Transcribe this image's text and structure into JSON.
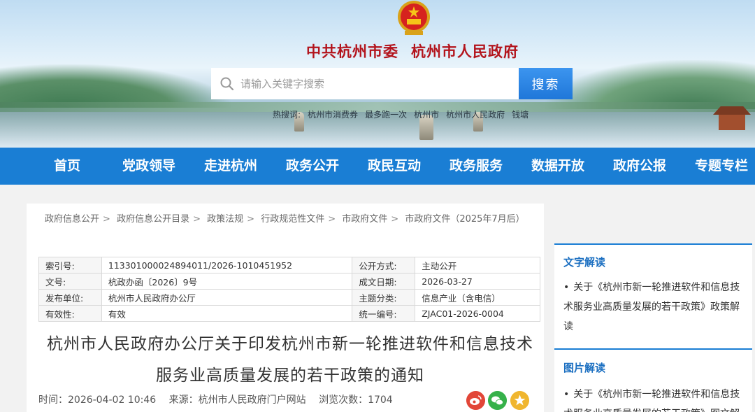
{
  "header": {
    "emblem_icon": "national-emblem-icon",
    "title_left": "中共杭州市委",
    "title_right": "杭州市人民政府"
  },
  "search": {
    "placeholder": "请输入关键字搜索",
    "button_label": "搜索",
    "hot_links": [
      "热搜词:",
      "杭州市消费券",
      "最多跑一次",
      "杭州市",
      "杭州市人民政府",
      "钱塘"
    ]
  },
  "nav": {
    "items": [
      "首页",
      "党政领导",
      "走进杭州",
      "政务公开",
      "政民互动",
      "政务服务",
      "数据开放",
      "政府公报",
      "专题专栏"
    ]
  },
  "breadcrumb": [
    "政府信息公开",
    "政府信息公开目录",
    "政策法规",
    "行政规范性文件",
    "市政府文件",
    "市政府文件（2025年7月后）"
  ],
  "info_table": {
    "rows": [
      {
        "label": "索引号:",
        "value": "113301000024894011/2026-1010451952",
        "label2": "公开方式:",
        "value2": "主动公开"
      },
      {
        "label": "文号:",
        "value": "杭政办函〔2026〕9号",
        "label2": "成文日期:",
        "value2": "2026-03-27"
      },
      {
        "label": "发布单位:",
        "value": "杭州市人民政府办公厅",
        "label2": "主题分类:",
        "value2": "信息产业（含电信）"
      },
      {
        "label": "有效性:",
        "value": "有效",
        "label2": "统一编号:",
        "value2": "ZJAC01-2026-0004"
      }
    ]
  },
  "document": {
    "title_line1": "杭州市人民政府办公厅关于印发杭州市新一轮推进软件和信息技术",
    "title_line2": "服务业高质量发展的若干政策的通知",
    "time": "时间：2026-04-02 10:46",
    "source": "来源：杭州市人民政府门户网站",
    "views": "浏览次数：1704"
  },
  "side": {
    "text_heading": "文字解读",
    "text_link": "关于《杭州市新一轮推进软件和信息技术服务业高质量发展的若干政策》政策解读",
    "image_heading": "图片解读",
    "image_link": "关于《杭州市新一轮推进软件和信息技术服务业高质量发展的若干政策》图文解"
  },
  "colors": {
    "nav_blue": "#1a7ed4",
    "title_red": "#b3141c",
    "side_heading_blue": "#1b6fc1"
  }
}
